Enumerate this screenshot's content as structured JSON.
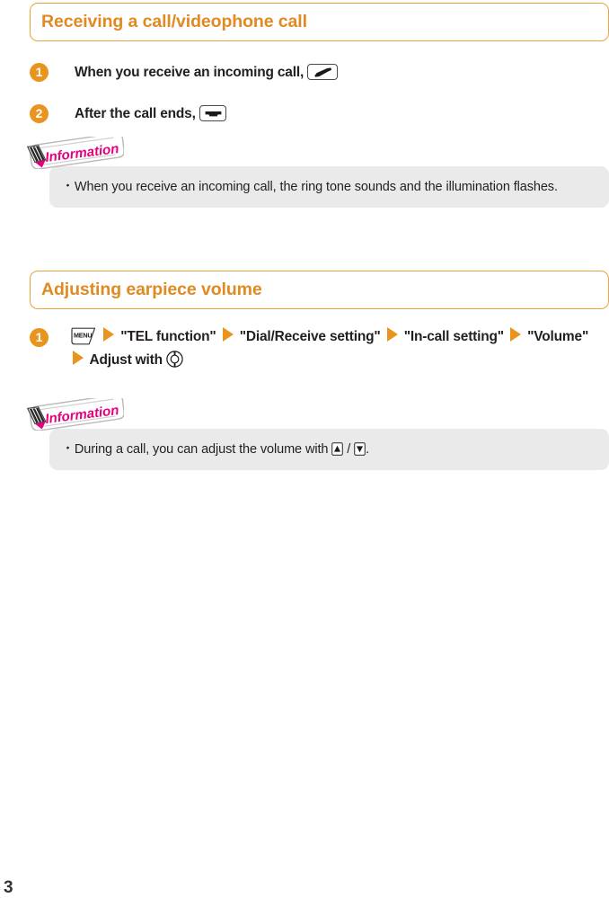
{
  "document": {
    "page_number": "3",
    "accent_color": "#E08A22",
    "badge_color": "#E8941E",
    "info_tab_color": "#E6007E",
    "info_box_bg": "#EAEAEA"
  },
  "sections": [
    {
      "heading": "Receiving a call/videophone call",
      "steps": [
        {
          "number": "1",
          "text_before": "When you receive an incoming call,",
          "icon": "call-key-icon",
          "icon_label": "Call key"
        },
        {
          "number": "2",
          "text_before": "After the call ends,",
          "icon": "end-key-icon",
          "icon_label": "End key"
        }
      ],
      "information": {
        "tab_label": "Information",
        "tab_icon": "pen-icon",
        "bullet": "・",
        "text": "When you receive an incoming call, the ring tone sounds and the illumination flashes."
      }
    },
    {
      "heading": "Adjusting earpiece volume",
      "steps": [
        {
          "number": "1",
          "sequence": [
            {
              "type": "icon",
              "icon": "menu-key-icon",
              "label": "MENU"
            },
            {
              "type": "arrow",
              "icon": "arrow-right-icon"
            },
            {
              "type": "text",
              "value": "\"TEL function\""
            },
            {
              "type": "arrow",
              "icon": "arrow-right-icon"
            },
            {
              "type": "text",
              "value": "\"Dial/Receive setting\""
            },
            {
              "type": "arrow",
              "icon": "arrow-right-icon"
            },
            {
              "type": "text",
              "value": "\"In-call setting\""
            },
            {
              "type": "arrow",
              "icon": "arrow-right-icon"
            },
            {
              "type": "text",
              "value": "\"Volume\""
            },
            {
              "type": "arrow",
              "icon": "arrow-right-icon"
            },
            {
              "type": "text",
              "value": "Adjust with"
            },
            {
              "type": "icon",
              "icon": "nav-key-icon",
              "label": "Navigation key"
            }
          ]
        }
      ],
      "information": {
        "tab_label": "Information",
        "tab_icon": "pen-icon",
        "bullet": "・",
        "text_before": "During a call, you can adjust the volume with",
        "icon_up": "volume-up-key-icon",
        "separator": "/",
        "icon_down": "volume-down-key-icon",
        "text_after": "."
      }
    }
  ]
}
